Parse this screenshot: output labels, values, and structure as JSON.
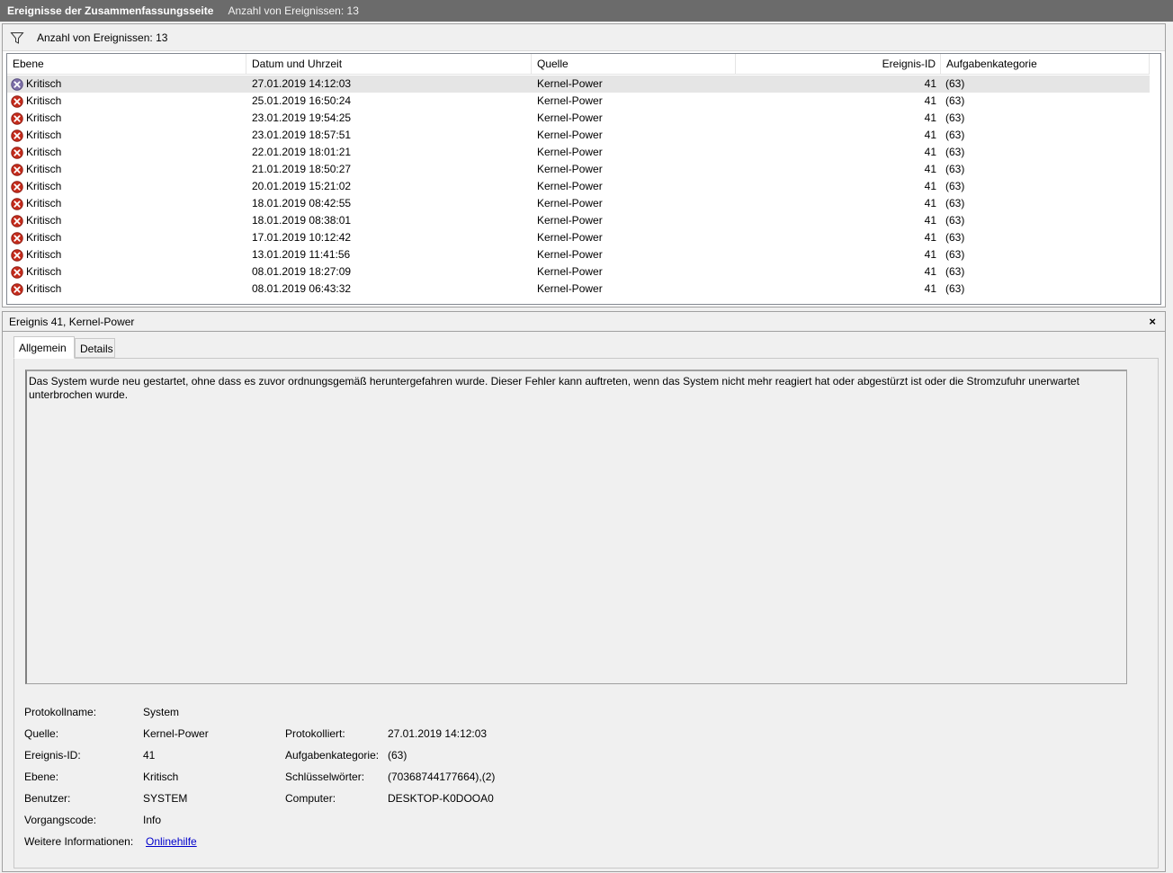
{
  "titlebar": {
    "title": "Ereignisse der Zusammenfassungsseite",
    "count": "Anzahl von Ereignissen: 13"
  },
  "filter": {
    "icon": "filter-funnel-icon",
    "label": "Anzahl von Ereignissen: 13"
  },
  "table": {
    "columns": {
      "level": "Ebene",
      "date": "Datum und Uhrzeit",
      "source": "Quelle",
      "event_id": "Ereignis-ID",
      "category": "Aufgabenkategorie"
    },
    "rows": [
      {
        "level": "Kritisch",
        "date": "27.01.2019 14:12:03",
        "source": "Kernel-Power",
        "event_id": "41",
        "category": "(63)"
      },
      {
        "level": "Kritisch",
        "date": "25.01.2019 16:50:24",
        "source": "Kernel-Power",
        "event_id": "41",
        "category": "(63)"
      },
      {
        "level": "Kritisch",
        "date": "23.01.2019 19:54:25",
        "source": "Kernel-Power",
        "event_id": "41",
        "category": "(63)"
      },
      {
        "level": "Kritisch",
        "date": "23.01.2019 18:57:51",
        "source": "Kernel-Power",
        "event_id": "41",
        "category": "(63)"
      },
      {
        "level": "Kritisch",
        "date": "22.01.2019 18:01:21",
        "source": "Kernel-Power",
        "event_id": "41",
        "category": "(63)"
      },
      {
        "level": "Kritisch",
        "date": "21.01.2019 18:50:27",
        "source": "Kernel-Power",
        "event_id": "41",
        "category": "(63)"
      },
      {
        "level": "Kritisch",
        "date": "20.01.2019 15:21:02",
        "source": "Kernel-Power",
        "event_id": "41",
        "category": "(63)"
      },
      {
        "level": "Kritisch",
        "date": "18.01.2019 08:42:55",
        "source": "Kernel-Power",
        "event_id": "41",
        "category": "(63)"
      },
      {
        "level": "Kritisch",
        "date": "18.01.2019 08:38:01",
        "source": "Kernel-Power",
        "event_id": "41",
        "category": "(63)"
      },
      {
        "level": "Kritisch",
        "date": "17.01.2019 10:12:42",
        "source": "Kernel-Power",
        "event_id": "41",
        "category": "(63)"
      },
      {
        "level": "Kritisch",
        "date": "13.01.2019 11:41:56",
        "source": "Kernel-Power",
        "event_id": "41",
        "category": "(63)"
      },
      {
        "level": "Kritisch",
        "date": "08.01.2019 18:27:09",
        "source": "Kernel-Power",
        "event_id": "41",
        "category": "(63)"
      },
      {
        "level": "Kritisch",
        "date": "08.01.2019 06:43:32",
        "source": "Kernel-Power",
        "event_id": "41",
        "category": "(63)"
      }
    ],
    "selected_index": 0
  },
  "detail": {
    "title": "Ereignis 41, Kernel-Power",
    "close_label": "×",
    "tabs": [
      "Allgemein",
      "Details"
    ],
    "active_tab": 0,
    "description": "Das System wurde neu gestartet, ohne dass es zuvor ordnungsgemäß heruntergefahren wurde. Dieser Fehler kann auftreten, wenn das System nicht mehr reagiert hat oder abgestürzt ist oder die Stromzufuhr unerwartet unterbrochen wurde.",
    "props": {
      "logname_label": "Protokollname:",
      "logname_value": "System",
      "source_label": "Quelle:",
      "source_value": "Kernel-Power",
      "logged_label": "Protokolliert:",
      "logged_value": "27.01.2019 14:12:03",
      "eventid_label": "Ereignis-ID:",
      "eventid_value": "41",
      "taskcat_label": "Aufgabenkategorie:",
      "taskcat_value": "(63)",
      "level_label": "Ebene:",
      "level_value": "Kritisch",
      "keywords_label": "Schlüsselwörter:",
      "keywords_value": "(70368744177664),(2)",
      "user_label": "Benutzer:",
      "user_value": "SYSTEM",
      "computer_label": "Computer:",
      "computer_value": "DESKTOP-K0DOOA0",
      "opcode_label": "Vorgangscode:",
      "opcode_value": "Info",
      "moreinfo_label": "Weitere Informationen:",
      "moreinfo_link": "Onlinehilfe"
    }
  },
  "colors": {
    "titlebar_bg": "#6b6b6b",
    "critical_red": "#c42b1c",
    "selected_row": "#e5e5e5",
    "link": "#0000cc"
  }
}
